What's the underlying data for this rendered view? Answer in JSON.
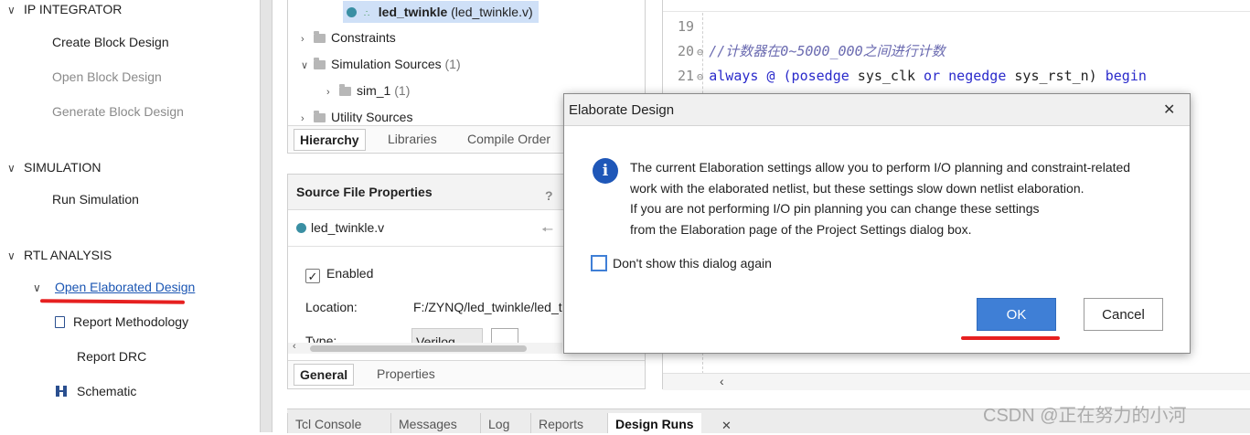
{
  "flow_nav": {
    "sections": [
      {
        "label": "IP INTEGRATOR",
        "items": [
          "Create Block Design",
          "Open Block Design",
          "Generate Block Design"
        ]
      },
      {
        "label": "SIMULATION",
        "items": [
          "Run Simulation"
        ]
      },
      {
        "label": "RTL ANALYSIS",
        "items": [
          "Open Elaborated Design",
          "Report Methodology",
          "Report DRC",
          "Schematic"
        ]
      }
    ]
  },
  "sources": {
    "selected_file": "led_twinkle",
    "selected_file_suffix": "(led_twinkle.v)",
    "tree": [
      {
        "label": "Constraints",
        "count": ""
      },
      {
        "label": "Simulation Sources",
        "count": "(1)"
      },
      {
        "label": "sim_1",
        "count": "(1)"
      },
      {
        "label": "Utility Sources",
        "count": ""
      }
    ],
    "tabs": [
      "Hierarchy",
      "Libraries",
      "Compile Order"
    ]
  },
  "properties": {
    "title": "Source File Properties",
    "help": "?",
    "file": "led_twinkle.v",
    "enabled_label": "Enabled",
    "location_label": "Location:",
    "location_value": "F:/ZYNQ/led_twinkle/led_t",
    "type_label": "Type:",
    "type_value": "Verilog",
    "tabs": [
      "General",
      "Properties"
    ]
  },
  "editor": {
    "lines": [
      {
        "n": "19"
      },
      {
        "n": "20",
        "comment": "//计数器在0~5000_000之间进行计数"
      },
      {
        "n": "21",
        "kw1": "always",
        "op": " @ (",
        "kw2": "posedge",
        "id1": " sys_clk ",
        "kw3": "or",
        "kw4": " negedge",
        "id2": " sys_rst_n) ",
        "kw5": "begin"
      }
    ]
  },
  "bottom_tabs": [
    "Tcl Console",
    "Messages",
    "Log",
    "Reports",
    "Design Runs"
  ],
  "dialog": {
    "title": "Elaborate Design",
    "message": [
      "The current Elaboration settings allow you to perform I/O planning and constraint-related",
      "work with the elaborated netlist, but these settings slow down netlist elaboration.",
      "If you are not performing I/O pin planning you can change these settings",
      "from the Elaboration page of the Project Settings dialog box."
    ],
    "checkbox_label": "Don't show this dialog again",
    "ok_label": "OK",
    "cancel_label": "Cancel"
  },
  "watermark": "CSDN @正在努力的小河",
  "colors": {
    "accent": "#3f7fd6",
    "annotation": "#e62020",
    "link": "#1b56b3"
  }
}
